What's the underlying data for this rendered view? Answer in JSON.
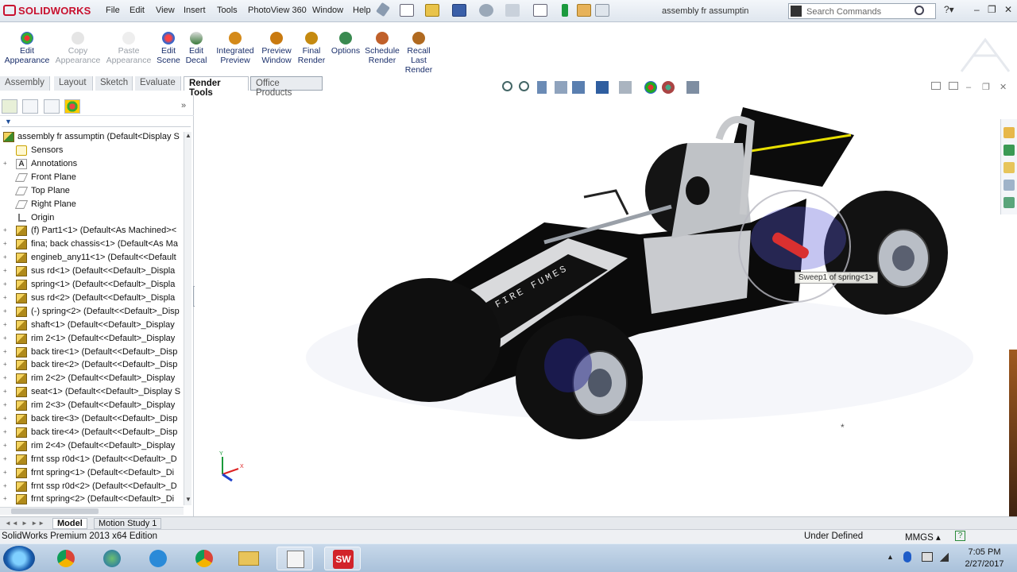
{
  "app": {
    "brand": "SOLIDWORKS",
    "document_title": "assembly fr assumptin",
    "search_placeholder": "Search Commands"
  },
  "menu": [
    "File",
    "Edit",
    "View",
    "Insert",
    "Tools",
    "PhotoView 360",
    "Window",
    "Help"
  ],
  "commands": [
    {
      "label": "Edit\nAppearance",
      "enabled": true,
      "icon": "appearance-ball-icon"
    },
    {
      "label": "Copy\nAppearance",
      "enabled": false,
      "icon": "copy-appearance-icon"
    },
    {
      "label": "Paste\nAppearance",
      "enabled": false,
      "icon": "paste-appearance-icon"
    },
    {
      "label": "Edit\nScene",
      "enabled": true,
      "icon": "scene-icon"
    },
    {
      "label": "Edit\nDecal",
      "enabled": true,
      "icon": "decal-icon"
    },
    {
      "label": "Integrated\nPreview",
      "enabled": true,
      "icon": "integrated-preview-icon"
    },
    {
      "label": "Preview\nWindow",
      "enabled": true,
      "icon": "preview-window-icon"
    },
    {
      "label": "Final\nRender",
      "enabled": true,
      "icon": "final-render-icon"
    },
    {
      "label": "Options",
      "enabled": true,
      "icon": "options-gear-icon"
    },
    {
      "label": "Schedule\nRender",
      "enabled": true,
      "icon": "schedule-render-icon"
    },
    {
      "label": "Recall\nLast\nRender",
      "enabled": true,
      "icon": "recall-render-icon"
    }
  ],
  "tabs": [
    "Assembly",
    "Layout",
    "Sketch",
    "Evaluate",
    "Render Tools",
    "Office Products"
  ],
  "active_tab": "Render Tools",
  "tree": {
    "root": "assembly fr assumptin  (Default<Display S",
    "items": [
      {
        "label": "Sensors",
        "icon": "sensor"
      },
      {
        "label": "Annotations",
        "icon": "annot"
      },
      {
        "label": "Front Plane",
        "icon": "plane"
      },
      {
        "label": "Top Plane",
        "icon": "plane"
      },
      {
        "label": "Right Plane",
        "icon": "plane"
      },
      {
        "label": "Origin",
        "icon": "origin"
      },
      {
        "label": "(f) Part1<1> (Default<As Machined><",
        "icon": "part"
      },
      {
        "label": "fina; back chassis<1> (Default<As Ma",
        "icon": "part"
      },
      {
        "label": "engineb_any11<1> (Default<<Default",
        "icon": "part"
      },
      {
        "label": "sus rd<1> (Default<<Default>_Displa",
        "icon": "part"
      },
      {
        "label": "spring<1> (Default<<Default>_Displa",
        "icon": "part"
      },
      {
        "label": "sus rd<2> (Default<<Default>_Displa",
        "icon": "part"
      },
      {
        "label": "(-) spring<2> (Default<<Default>_Disp",
        "icon": "part"
      },
      {
        "label": "shaft<1> (Default<<Default>_Display",
        "icon": "part"
      },
      {
        "label": "rim 2<1> (Default<<Default>_Display",
        "icon": "part"
      },
      {
        "label": "back tire<1> (Default<<Default>_Disp",
        "icon": "part"
      },
      {
        "label": "back tire<2> (Default<<Default>_Disp",
        "icon": "part"
      },
      {
        "label": "rim 2<2> (Default<<Default>_Display",
        "icon": "part"
      },
      {
        "label": "seat<1> (Default<<Default>_Display S",
        "icon": "part"
      },
      {
        "label": "rim 2<3> (Default<<Default>_Display",
        "icon": "part"
      },
      {
        "label": "back tire<3> (Default<<Default>_Disp",
        "icon": "part"
      },
      {
        "label": "back tire<4> (Default<<Default>_Disp",
        "icon": "part"
      },
      {
        "label": "rim 2<4> (Default<<Default>_Display",
        "icon": "part"
      },
      {
        "label": "frnt ssp r0d<1> (Default<<Default>_D",
        "icon": "part"
      },
      {
        "label": "frnt spring<1> (Default<<Default>_Di",
        "icon": "part"
      },
      {
        "label": "frnt ssp r0d<2> (Default<<Default>_D",
        "icon": "part"
      },
      {
        "label": "frnt spring<2> (Default<<Default>_Di",
        "icon": "part"
      }
    ]
  },
  "viewport": {
    "car_text": "FIRE FUMES",
    "tooltip": "Sweep1 of spring<1>"
  },
  "bottom_tabs": [
    "Model",
    "Motion Study 1"
  ],
  "status": {
    "edition": "SolidWorks Premium 2013 x64 Edition",
    "state": "Under Defined",
    "units": "MMGS"
  },
  "taskbar": {
    "time": "7:05 PM",
    "date": "2/27/2017"
  },
  "colors": {
    "brand_red": "#c8102e",
    "command_text": "#1a2f6b",
    "taskbar": "#b5cbe1"
  }
}
